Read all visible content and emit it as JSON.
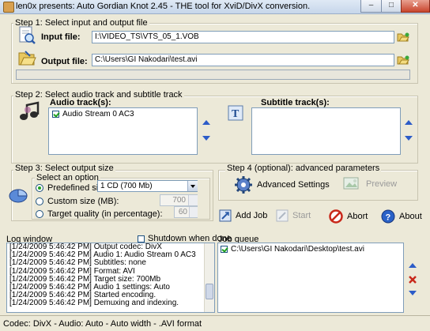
{
  "window": {
    "title": "len0x presents: Auto Gordian Knot 2.45 - THE tool for XviD/DivX conversion.",
    "min_glyph": "–",
    "max_glyph": "□",
    "close_glyph": "✕"
  },
  "step1": {
    "label": "Step 1: Select input and output file",
    "input_label": "Input file:",
    "input_value": "I:\\VIDEO_TS\\VTS_05_1.VOB",
    "output_label": "Output file:",
    "output_value": "C:\\Users\\GI Nakodari\\test.avi"
  },
  "step2": {
    "label": "Step 2: Select audio track and subtitle track",
    "audio_label": "Audio track(s):",
    "audio_tracks": [
      "Audio Stream 0 AC3"
    ],
    "subtitle_label": "Subtitle track(s):"
  },
  "step3": {
    "label": "Step 3: Select output size",
    "option_label": "Select an option",
    "predefined_label": "Predefined size:",
    "predefined_value": "1 CD (700 Mb)",
    "custom_label": "Custom size (MB):",
    "custom_value": "700",
    "quality_label": "Target quality (in percentage):",
    "quality_value": "60"
  },
  "step4": {
    "label": "Step 4 (optional): advanced parameters",
    "advanced_label": "Advanced Settings",
    "preview_label": "Preview"
  },
  "actions": {
    "add_job": "Add Job",
    "start": "Start",
    "abort": "Abort",
    "about": "About"
  },
  "log": {
    "label": "Log window",
    "shutdown_label": "Shutdown when done",
    "lines": [
      "[1/24/2009 5:46:42 PM] Output codec: DivX",
      "[1/24/2009 5:46:42 PM] Audio 1: Audio Stream 0 AC3",
      "[1/24/2009 5:46:42 PM] Subtitles: none",
      "[1/24/2009 5:46:42 PM] Format: AVI",
      "[1/24/2009 5:46:42 PM] Target size: 700Mb",
      "[1/24/2009 5:46:42 PM] Audio 1 settings: Auto",
      "[1/24/2009 5:46:42 PM] Started encoding.",
      "[1/24/2009 5:46:42 PM] Demuxing and indexing."
    ]
  },
  "jobs": {
    "label": "Job queue",
    "items": [
      "C:\\Users\\GI Nakodari\\Desktop\\test.avi"
    ]
  },
  "status": {
    "text": "Codec: DivX -  Audio: Auto -  Auto width - .AVI format"
  }
}
